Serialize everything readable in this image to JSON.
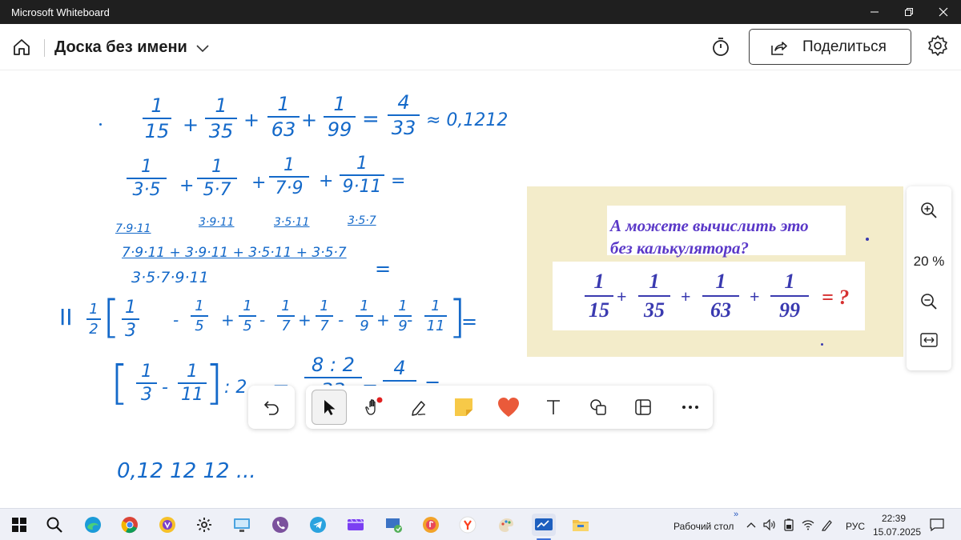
{
  "window": {
    "title": "Microsoft Whiteboard"
  },
  "header": {
    "board_name": "Доска без имени",
    "share_label": "Поделиться"
  },
  "handwriting": {
    "row1": {
      "fractions": [
        {
          "n": "1",
          "d": "15"
        },
        {
          "n": "1",
          "d": "35"
        },
        {
          "n": "1",
          "d": "63"
        },
        {
          "n": "1",
          "d": "99"
        },
        {
          "n": "4",
          "d": "33"
        }
      ],
      "ops": [
        "+",
        "+",
        "+",
        "="
      ],
      "approx": "≈ 0,1212"
    },
    "row2": {
      "fractions": [
        {
          "n": "1",
          "d": "3·5"
        },
        {
          "n": "1",
          "d": "5·7"
        },
        {
          "n": "1",
          "d": "7·9"
        },
        {
          "n": "1",
          "d": "9·11"
        }
      ],
      "ops": [
        "+",
        "+",
        "+",
        "="
      ],
      "multipliers": [
        "7·9·11",
        "3·9·11",
        "3·5·11",
        "3·5·7"
      ]
    },
    "row3": {
      "numerator": "7·9·11 + 3·9·11 + 3·5·11 + 3·5·7",
      "denominator": "3·5·7·9·11",
      "eq": "="
    },
    "row4": {
      "label": "II",
      "factor_n": "1",
      "factor_d": "2",
      "terms": [
        {
          "sign": "",
          "n": "1",
          "d": "3"
        },
        {
          "sign": "-",
          "n": "1",
          "d": "5"
        },
        {
          "sign": "+",
          "n": "1",
          "d": "5"
        },
        {
          "sign": "-",
          "n": "1",
          "d": "7"
        },
        {
          "sign": "+",
          "n": "1",
          "d": "7"
        },
        {
          "sign": "-",
          "n": "1",
          "d": "9"
        },
        {
          "sign": "+",
          "n": "1",
          "d": "9"
        },
        {
          "sign": "-",
          "n": "1",
          "d": "11"
        }
      ],
      "eq": "="
    },
    "row5": {
      "a_n": "1",
      "a_d": "3",
      "minus": "-",
      "b_n": "1",
      "b_d": "11",
      "div": ": 2",
      "eq1": "=",
      "res1_n": "8 : 2",
      "res1_d": "33",
      "eq2": "=",
      "res2_n": "4",
      "res2_d": "33",
      "eq3": "="
    },
    "row6": "0,12 12 12 ..."
  },
  "puzzle_card": {
    "question": "А можете вычислить это без калькулятора?",
    "fractions": [
      {
        "n": "1",
        "d": "15"
      },
      {
        "n": "1",
        "d": "35"
      },
      {
        "n": "1",
        "d": "63"
      },
      {
        "n": "1",
        "d": "99"
      }
    ],
    "ops": [
      "+",
      "+",
      "+"
    ],
    "result": "= ?"
  },
  "zoom": {
    "level": "20 %"
  },
  "taskbar": {
    "desktop_label": "Рабочий стол",
    "lang": "РУС",
    "time": "22:39",
    "date": "15.07.2025"
  },
  "colors": {
    "ink": "#1469c9",
    "card_bg": "#f3ecca",
    "card_text": "#5a38c8",
    "formula": "#3a3ab0",
    "question_mark": "#d63030"
  }
}
